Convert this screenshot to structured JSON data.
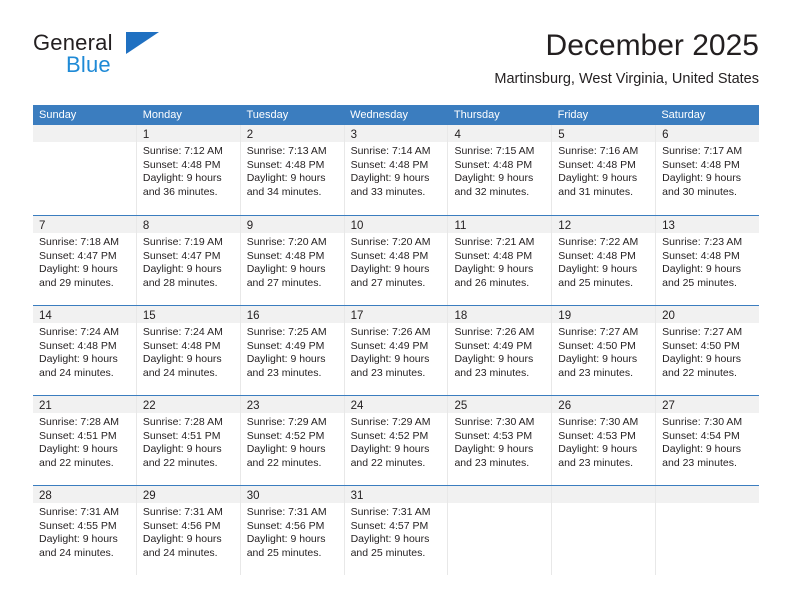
{
  "brand": {
    "name_top": "General",
    "name_bottom": "Blue"
  },
  "header": {
    "month_title": "December 2025",
    "location": "Martinsburg, West Virginia, United States"
  },
  "colors": {
    "header_blue": "#3b7dbf",
    "brand_blue": "#1f8ad6",
    "logo_triangle": "#1f70c1",
    "daynum_band": "#f1f1f1",
    "cell_border": "#e8e8e8",
    "text": "#231f20"
  },
  "weekdays": [
    "Sunday",
    "Monday",
    "Tuesday",
    "Wednesday",
    "Thursday",
    "Friday",
    "Saturday"
  ],
  "weeks": [
    [
      {
        "day": "",
        "empty": true,
        "sunrise": "",
        "sunset": "",
        "daylight_1": "",
        "daylight_2": ""
      },
      {
        "day": "1",
        "sunrise": "Sunrise: 7:12 AM",
        "sunset": "Sunset: 4:48 PM",
        "daylight_1": "Daylight: 9 hours",
        "daylight_2": "and 36 minutes."
      },
      {
        "day": "2",
        "sunrise": "Sunrise: 7:13 AM",
        "sunset": "Sunset: 4:48 PM",
        "daylight_1": "Daylight: 9 hours",
        "daylight_2": "and 34 minutes."
      },
      {
        "day": "3",
        "sunrise": "Sunrise: 7:14 AM",
        "sunset": "Sunset: 4:48 PM",
        "daylight_1": "Daylight: 9 hours",
        "daylight_2": "and 33 minutes."
      },
      {
        "day": "4",
        "sunrise": "Sunrise: 7:15 AM",
        "sunset": "Sunset: 4:48 PM",
        "daylight_1": "Daylight: 9 hours",
        "daylight_2": "and 32 minutes."
      },
      {
        "day": "5",
        "sunrise": "Sunrise: 7:16 AM",
        "sunset": "Sunset: 4:48 PM",
        "daylight_1": "Daylight: 9 hours",
        "daylight_2": "and 31 minutes."
      },
      {
        "day": "6",
        "sunrise": "Sunrise: 7:17 AM",
        "sunset": "Sunset: 4:48 PM",
        "daylight_1": "Daylight: 9 hours",
        "daylight_2": "and 30 minutes."
      }
    ],
    [
      {
        "day": "7",
        "sunrise": "Sunrise: 7:18 AM",
        "sunset": "Sunset: 4:47 PM",
        "daylight_1": "Daylight: 9 hours",
        "daylight_2": "and 29 minutes."
      },
      {
        "day": "8",
        "sunrise": "Sunrise: 7:19 AM",
        "sunset": "Sunset: 4:47 PM",
        "daylight_1": "Daylight: 9 hours",
        "daylight_2": "and 28 minutes."
      },
      {
        "day": "9",
        "sunrise": "Sunrise: 7:20 AM",
        "sunset": "Sunset: 4:48 PM",
        "daylight_1": "Daylight: 9 hours",
        "daylight_2": "and 27 minutes."
      },
      {
        "day": "10",
        "sunrise": "Sunrise: 7:20 AM",
        "sunset": "Sunset: 4:48 PM",
        "daylight_1": "Daylight: 9 hours",
        "daylight_2": "and 27 minutes."
      },
      {
        "day": "11",
        "sunrise": "Sunrise: 7:21 AM",
        "sunset": "Sunset: 4:48 PM",
        "daylight_1": "Daylight: 9 hours",
        "daylight_2": "and 26 minutes."
      },
      {
        "day": "12",
        "sunrise": "Sunrise: 7:22 AM",
        "sunset": "Sunset: 4:48 PM",
        "daylight_1": "Daylight: 9 hours",
        "daylight_2": "and 25 minutes."
      },
      {
        "day": "13",
        "sunrise": "Sunrise: 7:23 AM",
        "sunset": "Sunset: 4:48 PM",
        "daylight_1": "Daylight: 9 hours",
        "daylight_2": "and 25 minutes."
      }
    ],
    [
      {
        "day": "14",
        "sunrise": "Sunrise: 7:24 AM",
        "sunset": "Sunset: 4:48 PM",
        "daylight_1": "Daylight: 9 hours",
        "daylight_2": "and 24 minutes."
      },
      {
        "day": "15",
        "sunrise": "Sunrise: 7:24 AM",
        "sunset": "Sunset: 4:48 PM",
        "daylight_1": "Daylight: 9 hours",
        "daylight_2": "and 24 minutes."
      },
      {
        "day": "16",
        "sunrise": "Sunrise: 7:25 AM",
        "sunset": "Sunset: 4:49 PM",
        "daylight_1": "Daylight: 9 hours",
        "daylight_2": "and 23 minutes."
      },
      {
        "day": "17",
        "sunrise": "Sunrise: 7:26 AM",
        "sunset": "Sunset: 4:49 PM",
        "daylight_1": "Daylight: 9 hours",
        "daylight_2": "and 23 minutes."
      },
      {
        "day": "18",
        "sunrise": "Sunrise: 7:26 AM",
        "sunset": "Sunset: 4:49 PM",
        "daylight_1": "Daylight: 9 hours",
        "daylight_2": "and 23 minutes."
      },
      {
        "day": "19",
        "sunrise": "Sunrise: 7:27 AM",
        "sunset": "Sunset: 4:50 PM",
        "daylight_1": "Daylight: 9 hours",
        "daylight_2": "and 23 minutes."
      },
      {
        "day": "20",
        "sunrise": "Sunrise: 7:27 AM",
        "sunset": "Sunset: 4:50 PM",
        "daylight_1": "Daylight: 9 hours",
        "daylight_2": "and 22 minutes."
      }
    ],
    [
      {
        "day": "21",
        "sunrise": "Sunrise: 7:28 AM",
        "sunset": "Sunset: 4:51 PM",
        "daylight_1": "Daylight: 9 hours",
        "daylight_2": "and 22 minutes."
      },
      {
        "day": "22",
        "sunrise": "Sunrise: 7:28 AM",
        "sunset": "Sunset: 4:51 PM",
        "daylight_1": "Daylight: 9 hours",
        "daylight_2": "and 22 minutes."
      },
      {
        "day": "23",
        "sunrise": "Sunrise: 7:29 AM",
        "sunset": "Sunset: 4:52 PM",
        "daylight_1": "Daylight: 9 hours",
        "daylight_2": "and 22 minutes."
      },
      {
        "day": "24",
        "sunrise": "Sunrise: 7:29 AM",
        "sunset": "Sunset: 4:52 PM",
        "daylight_1": "Daylight: 9 hours",
        "daylight_2": "and 22 minutes."
      },
      {
        "day": "25",
        "sunrise": "Sunrise: 7:30 AM",
        "sunset": "Sunset: 4:53 PM",
        "daylight_1": "Daylight: 9 hours",
        "daylight_2": "and 23 minutes."
      },
      {
        "day": "26",
        "sunrise": "Sunrise: 7:30 AM",
        "sunset": "Sunset: 4:53 PM",
        "daylight_1": "Daylight: 9 hours",
        "daylight_2": "and 23 minutes."
      },
      {
        "day": "27",
        "sunrise": "Sunrise: 7:30 AM",
        "sunset": "Sunset: 4:54 PM",
        "daylight_1": "Daylight: 9 hours",
        "daylight_2": "and 23 minutes."
      }
    ],
    [
      {
        "day": "28",
        "sunrise": "Sunrise: 7:31 AM",
        "sunset": "Sunset: 4:55 PM",
        "daylight_1": "Daylight: 9 hours",
        "daylight_2": "and 24 minutes."
      },
      {
        "day": "29",
        "sunrise": "Sunrise: 7:31 AM",
        "sunset": "Sunset: 4:56 PM",
        "daylight_1": "Daylight: 9 hours",
        "daylight_2": "and 24 minutes."
      },
      {
        "day": "30",
        "sunrise": "Sunrise: 7:31 AM",
        "sunset": "Sunset: 4:56 PM",
        "daylight_1": "Daylight: 9 hours",
        "daylight_2": "and 25 minutes."
      },
      {
        "day": "31",
        "sunrise": "Sunrise: 7:31 AM",
        "sunset": "Sunset: 4:57 PM",
        "daylight_1": "Daylight: 9 hours",
        "daylight_2": "and 25 minutes."
      },
      {
        "day": "",
        "empty": true,
        "sunrise": "",
        "sunset": "",
        "daylight_1": "",
        "daylight_2": ""
      },
      {
        "day": "",
        "empty": true,
        "sunrise": "",
        "sunset": "",
        "daylight_1": "",
        "daylight_2": ""
      },
      {
        "day": "",
        "empty": true,
        "sunrise": "",
        "sunset": "",
        "daylight_1": "",
        "daylight_2": ""
      }
    ]
  ]
}
